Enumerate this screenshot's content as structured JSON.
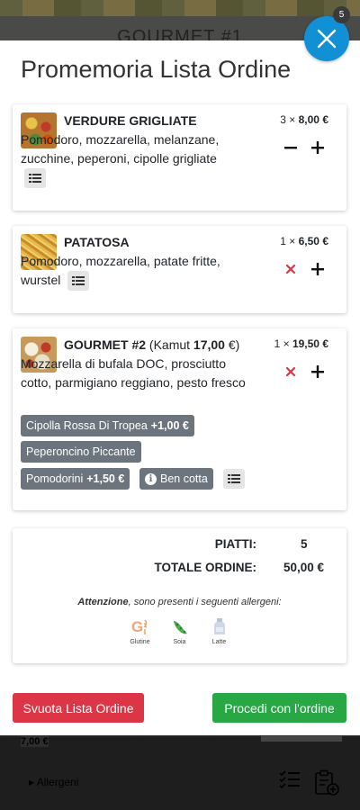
{
  "background": {
    "title": "GOURMET #1",
    "price": "7,00 €",
    "allergeni_link": "Allergeni",
    "arrow": "▸"
  },
  "modal": {
    "title": "Promemoria Lista Ordine",
    "close_badge": "5"
  },
  "items": [
    {
      "name": "VERDURE GRIGLIATE",
      "ingredients": "Pomodoro, mozzarella, melanzane, zucchine, peperoni, cipolle grigliate",
      "qty": "3 ×",
      "price": "8,00 €"
    },
    {
      "name": "PATATOSA",
      "ingredients": "Pomodoro, mozzarella, patate fritte, wurstel",
      "qty": "1 ×",
      "price": "6,50 €"
    },
    {
      "name": "GOURMET #2",
      "variant_prefix": "(Kamut",
      "variant_price": "17,00",
      "variant_suffix": "€)",
      "ingredients": "Mozzarella di bufala DOC, prosciutto cotto, parmigiano reggiano, pesto fresco",
      "qty": "1 ×",
      "price": "19,50 €",
      "extras": [
        {
          "label": "Cipolla Rossa Di Tropea",
          "price": "+1,00 €"
        },
        {
          "label": "Peperoncino Piccante",
          "price": ""
        },
        {
          "label": "Pomodorini",
          "price": "+1,50 €"
        },
        {
          "label": "Ben cotta",
          "price": ""
        }
      ]
    }
  ],
  "summary": {
    "dishes_label": "PIATTI:",
    "dishes_value": "5",
    "total_label": "TOTALE ORDINE:",
    "total_value": "50,00 €",
    "allergen_note_bold": "Attenzione",
    "allergen_note_rest": ", sono presenti i seguenti allergeni:",
    "allergens": [
      "Glutine",
      "Soia",
      "Latte"
    ]
  },
  "actions": {
    "clear": "Svuota Lista Ordine",
    "proceed": "Procedi con l'ordine"
  },
  "colors": {
    "close_button": "#1190d6",
    "danger": "#dc3545",
    "success": "#28a745",
    "badge": "#6c757d"
  }
}
